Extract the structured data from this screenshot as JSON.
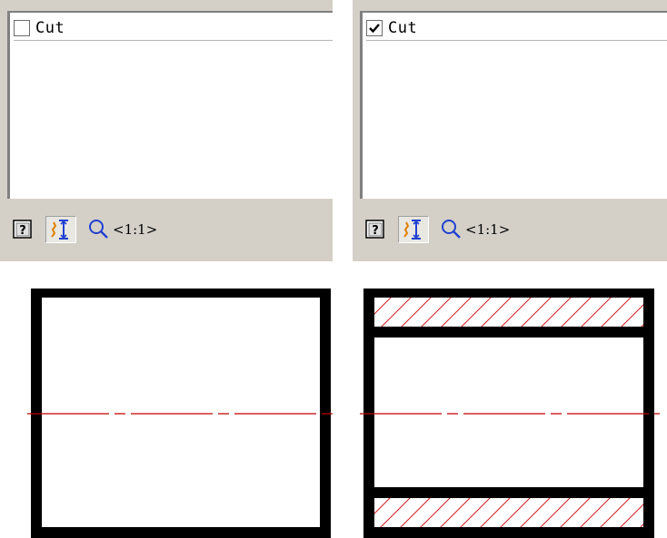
{
  "panels": [
    {
      "row_label": "Cut",
      "checked": false,
      "zoom_label": "<1:1>"
    },
    {
      "row_label": "Cut",
      "checked": true,
      "zoom_label": "<1:1>"
    }
  ],
  "colors": {
    "panel_bg": "#d4d0c8",
    "outline": "#000000",
    "centerline": "#c00000",
    "hatch": "#d02020",
    "icon_blue": "#2040d0",
    "icon_orange": "#e08000"
  },
  "icons": {
    "help": "help-icon",
    "mode": "display-mode-icon",
    "zoom": "zoom-icon"
  }
}
